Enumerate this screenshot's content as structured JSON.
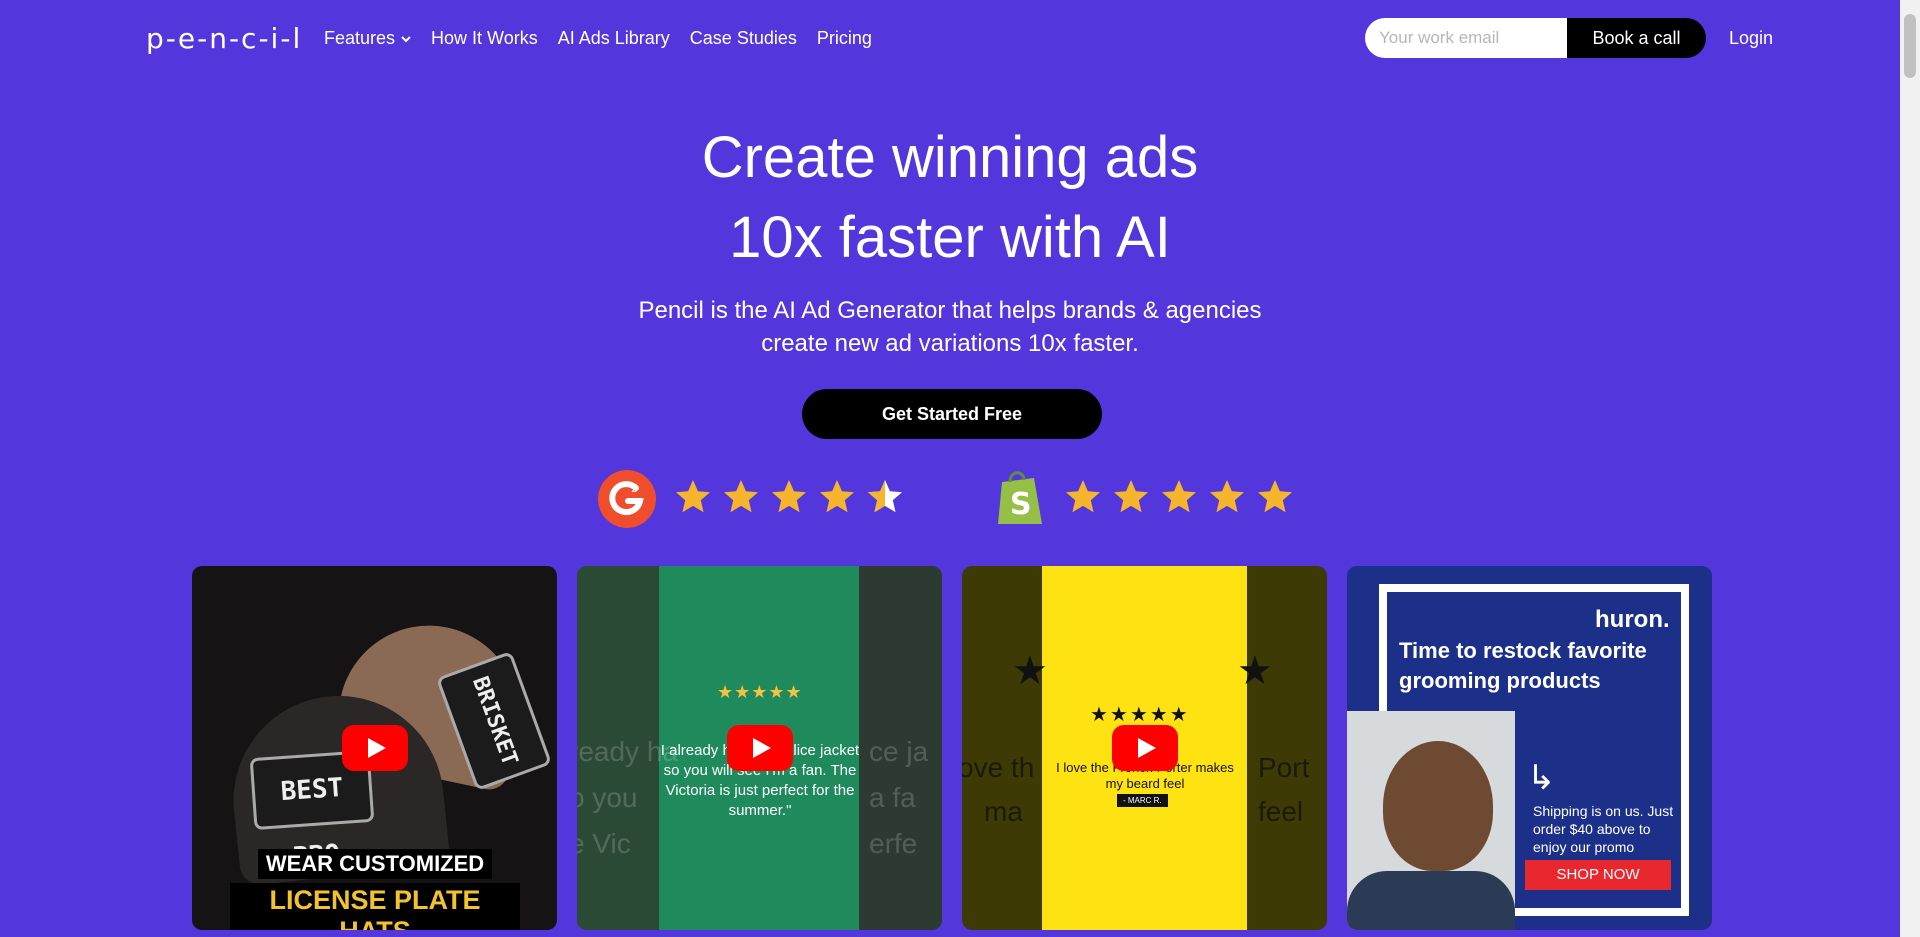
{
  "nav": {
    "logo": "p-e-n-c-i-l",
    "items": [
      "Features",
      "How It Works",
      "AI Ads Library",
      "Case Studies",
      "Pricing"
    ],
    "email_placeholder": "Your work email",
    "book_call": "Book a call",
    "login": "Login"
  },
  "hero": {
    "headline_line1": "Create winning ads",
    "headline_line2": "10x faster with AI",
    "sub_line1": "Pencil is the AI Ad Generator that helps brands & agencies",
    "sub_line2": "create new ad variations 10x faster.",
    "cta": "Get Started Free"
  },
  "ratings": {
    "g2_stars": 4.5,
    "shopify_stars": 5,
    "star_color": "#f6b52b"
  },
  "cards": {
    "card1": {
      "plate_front": "BEST BBQ",
      "plate_back": "BRISKET",
      "caption_line1": "WEAR CUSTOMIZED",
      "caption_line2": "LICENSE PLATE HATS"
    },
    "card2": {
      "stars": "★★★★★",
      "quote": "I already have the Alice jacket so you will see I'm a fan. The Victoria is just perfect for the summer.\""
    },
    "card3": {
      "stars": "★★★★★",
      "quote": "I love the French Porter makes my beard feel",
      "author": "- MARC R."
    },
    "card4": {
      "brand": "huron.",
      "headline": "Time to restock favorite grooming products",
      "shipping": "Shipping is on us. Just order $40 above to enjoy our promo",
      "shop_now": "SHOP NOW"
    }
  },
  "colors": {
    "background": "#5336dc",
    "button_dark": "#000000",
    "youtube_red": "#ff0000"
  }
}
